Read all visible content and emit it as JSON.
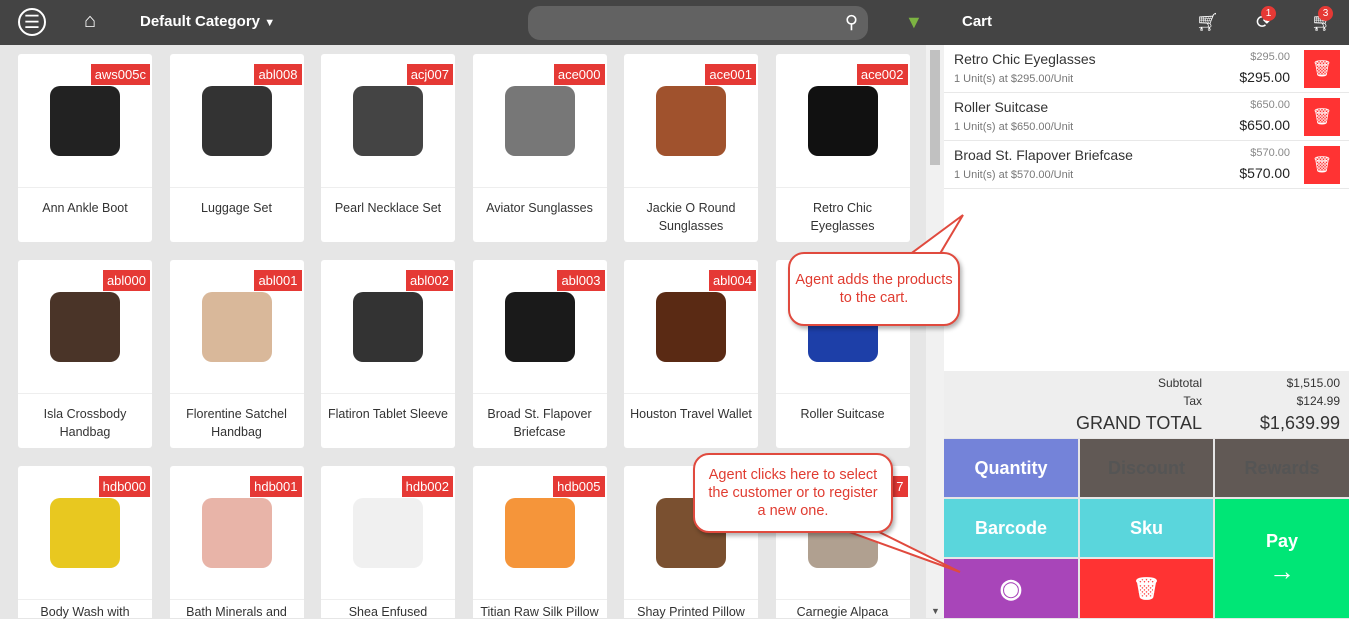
{
  "header": {
    "category": "Default Category",
    "cart_title": "Cart",
    "sync_badge": "1",
    "cart_badge": "3",
    "search_placeholder": ""
  },
  "products": [
    {
      "sku": "aws005c",
      "name": "Ann Ankle Boot",
      "color": "#222"
    },
    {
      "sku": "abl008",
      "name": "Luggage Set",
      "color": "#333"
    },
    {
      "sku": "acj007",
      "name": "Pearl Necklace Set",
      "color": "#444"
    },
    {
      "sku": "ace000",
      "name": "Aviator Sunglasses",
      "color": "#777"
    },
    {
      "sku": "ace001",
      "name": "Jackie O Round Sunglasses",
      "color": "#a0522d"
    },
    {
      "sku": "ace002",
      "name": "Retro Chic Eyeglasses",
      "color": "#111"
    },
    {
      "sku": "abl000",
      "name": "Isla Crossbody Handbag",
      "color": "#4a3428"
    },
    {
      "sku": "abl001",
      "name": "Florentine Satchel Handbag",
      "color": "#d9b89a"
    },
    {
      "sku": "abl002",
      "name": "Flatiron Tablet Sleeve",
      "color": "#333"
    },
    {
      "sku": "abl003",
      "name": "Broad St. Flapover Briefcase",
      "color": "#1a1a1a"
    },
    {
      "sku": "abl004",
      "name": "Houston Travel Wallet",
      "color": "#5a2a14"
    },
    {
      "sku": "",
      "name": "Roller Suitcase",
      "color": "#1d3fa8"
    },
    {
      "sku": "hdb000",
      "name": "Body Wash with",
      "color": "#e8c820"
    },
    {
      "sku": "hdb001",
      "name": "Bath Minerals and",
      "color": "#e8b4a8"
    },
    {
      "sku": "hdb002",
      "name": "Shea Enfused",
      "color": "#f0f0f0"
    },
    {
      "sku": "hdb005",
      "name": "Titian Raw Silk Pillow",
      "color": "#f5953a"
    },
    {
      "sku": "",
      "name": "Shay Printed Pillow",
      "color": "#7a5030"
    },
    {
      "sku": "7",
      "name": "Carnegie Alpaca",
      "color": "#b0a090"
    }
  ],
  "cart": {
    "items": [
      {
        "name": "Retro Chic Eyeglasses",
        "units": "1 Unit(s) at $295.00/Unit",
        "price": "$295.00",
        "total": "$295.00"
      },
      {
        "name": "Roller Suitcase",
        "units": "1 Unit(s) at $650.00/Unit",
        "price": "$650.00",
        "total": "$650.00"
      },
      {
        "name": "Broad St. Flapover Briefcase",
        "units": "1 Unit(s) at $570.00/Unit",
        "price": "$570.00",
        "total": "$570.00"
      }
    ],
    "subtotal_label": "Subtotal",
    "subtotal": "$1,515.00",
    "tax_label": "Tax",
    "tax": "$124.99",
    "grand_label": "GRAND TOTAL",
    "grand": "$1,639.99"
  },
  "actions": {
    "quantity": "Quantity",
    "discount": "Discount",
    "rewards": "Rewards",
    "barcode": "Barcode",
    "sku": "Sku",
    "pay": "Pay"
  },
  "colors": {
    "quantity": "#7483d9",
    "disabled": "#615955",
    "cyan": "#5ad6dc",
    "customer": "#a845b9",
    "delete": "#f33",
    "pay": "#00e676"
  },
  "callouts": {
    "cart": "Agent adds the products to the cart.",
    "customer": "Agent clicks here to select the customer or to register a new one."
  }
}
